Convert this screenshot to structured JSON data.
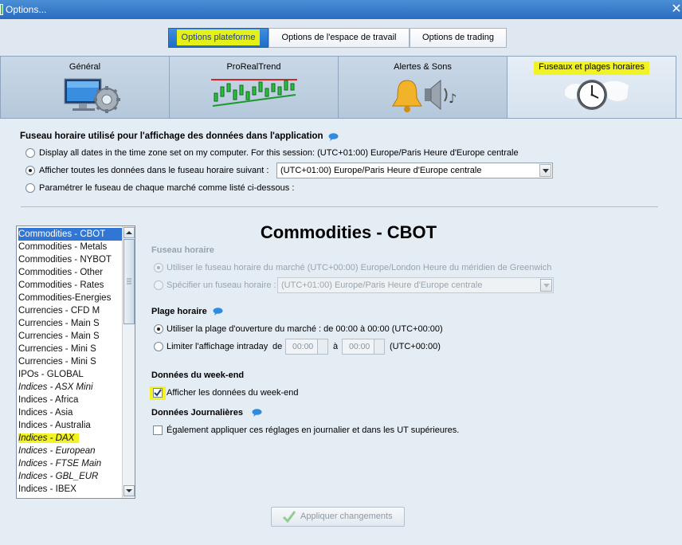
{
  "window": {
    "title": "Options..."
  },
  "top_tabs": [
    {
      "label": "Options plateforme"
    },
    {
      "label": "Options de l'espace de travail"
    },
    {
      "label": "Options de trading"
    }
  ],
  "big_tabs": [
    {
      "label": "Général",
      "icon": "monitor-gear-icon"
    },
    {
      "label": "ProRealTrend",
      "icon": "candlestick-trend-icon"
    },
    {
      "label": "Alertes & Sons",
      "icon": "bell-speaker-icon"
    },
    {
      "label": "Fuseaux et plages horaires",
      "icon": "world-clock-icon"
    }
  ],
  "timezone_section": {
    "heading": "Fuseau horaire utilisé pour l'affichage des données dans l'application",
    "options": [
      {
        "label": "Display all dates in the time zone set on my computer. For this session: (UTC+01:00) Europe/Paris Heure d'Europe centrale",
        "selected": false
      },
      {
        "label": "Afficher toutes les données dans le fuseau horaire suivant :",
        "selected": true
      },
      {
        "label": "Paramétrer le fuseau de chaque marché comme listé ci-dessous :",
        "selected": false
      }
    ],
    "select_value": "(UTC+01:00) Europe/Paris Heure d'Europe centrale"
  },
  "markets": [
    {
      "label": "Commodities - CBOT",
      "selected": true,
      "italic": false
    },
    {
      "label": "Commodities - Metals",
      "italic": false
    },
    {
      "label": "Commodities - NYBOT",
      "italic": false
    },
    {
      "label": "Commodities - Other",
      "italic": false
    },
    {
      "label": "Commodities - Rates",
      "italic": false
    },
    {
      "label": "Commodities-Energies",
      "italic": false
    },
    {
      "label": "Currencies - CFD M",
      "italic": false
    },
    {
      "label": "Currencies - Main S",
      "italic": false
    },
    {
      "label": "Currencies - Main S",
      "italic": false
    },
    {
      "label": "Currencies - Mini S",
      "italic": false
    },
    {
      "label": "Currencies - Mini S",
      "italic": false
    },
    {
      "label": "IPOs - GLOBAL",
      "italic": false
    },
    {
      "label": "Indices - ASX Mini",
      "italic": true
    },
    {
      "label": "Indices - Africa",
      "italic": false
    },
    {
      "label": "Indices - Asia",
      "italic": false
    },
    {
      "label": "Indices - Australia",
      "italic": false
    },
    {
      "label": "Indices - DAX",
      "italic": true,
      "highlighted": true
    },
    {
      "label": "Indices - European",
      "italic": true
    },
    {
      "label": "Indices - FTSE Main",
      "italic": true
    },
    {
      "label": "Indices - GBL_EUR",
      "italic": true
    },
    {
      "label": "Indices - IBEX",
      "italic": false
    }
  ],
  "detail": {
    "title": "Commodities - CBOT",
    "fuseau": {
      "heading": "Fuseau horaire",
      "opt1": "Utiliser le fuseau horaire du marché (UTC+00:00) Europe/London Heure du méridien de Greenwich",
      "opt2": "Spécifier un fuseau horaire :",
      "select_value": "(UTC+01:00) Europe/Paris Heure d'Europe centrale"
    },
    "plage": {
      "heading": "Plage horaire",
      "opt1": "Utiliser la plage d'ouverture du marché : de 00:00 à 00:00   (UTC+00:00)",
      "opt2": "Limiter l'affichage intraday",
      "de": "de",
      "a": "à",
      "from": "00:00",
      "to": "00:00",
      "tz": "(UTC+00:00)"
    },
    "weekend": {
      "heading": "Données du week-end",
      "checkbox_label": "Afficher les données du week-end",
      "checked": true
    },
    "journalieres": {
      "heading": "Données Journalières",
      "checkbox_label": "Également appliquer ces réglages en journalier et dans les UT supérieures.",
      "checked": false
    }
  },
  "apply_button": "Appliquer changements",
  "colors": {
    "accent": "#2a6cc0",
    "highlight": "#f2f324",
    "selection": "#3176d2"
  }
}
